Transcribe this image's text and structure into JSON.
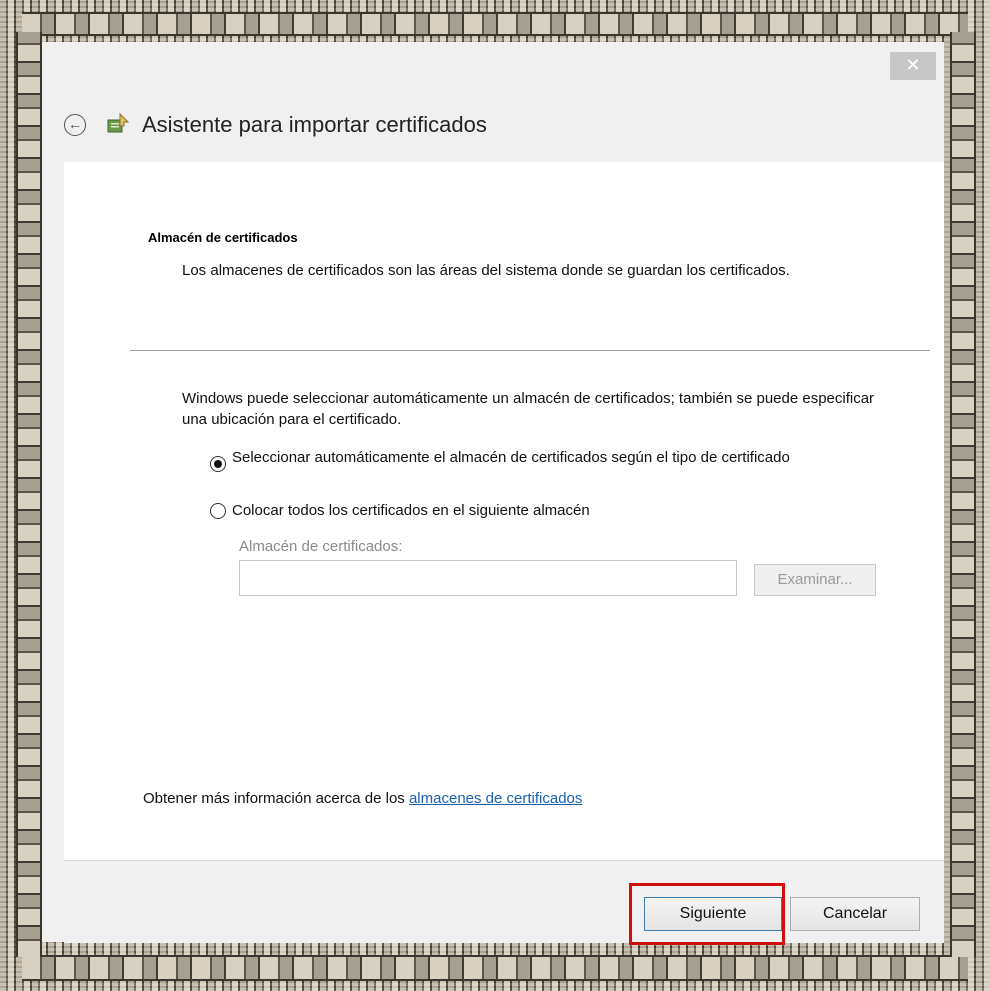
{
  "dialog": {
    "close_glyph": "✕",
    "back_glyph": "←",
    "title": "Asistente para importar certificados",
    "section": {
      "heading": "Almacén de certificados",
      "description": "Los almacenes de certificados son las áreas del sistema donde se guardan los certificados."
    },
    "intro": "Windows puede seleccionar automáticamente un almacén de certificados; también se puede especificar una ubicación para el certificado.",
    "options": [
      {
        "label": "Seleccionar automáticamente el almacén de certificados según el tipo de certificado",
        "selected": true
      },
      {
        "label": "Colocar todos los certificados en el siguiente almacén",
        "selected": false
      }
    ],
    "store_label": "Almacén de certificados:",
    "store_value": "",
    "browse_label": "Examinar...",
    "more_info_prefix": "Obtener más información acerca de los ",
    "more_info_link": "almacenes de certificados",
    "buttons": {
      "next": "Siguiente",
      "cancel": "Cancelar"
    }
  },
  "colors": {
    "highlight": "#d01010",
    "link": "#1a5fb4"
  },
  "icons": [
    "close-icon",
    "back-arrow-icon",
    "certificate-wizard-icon"
  ]
}
